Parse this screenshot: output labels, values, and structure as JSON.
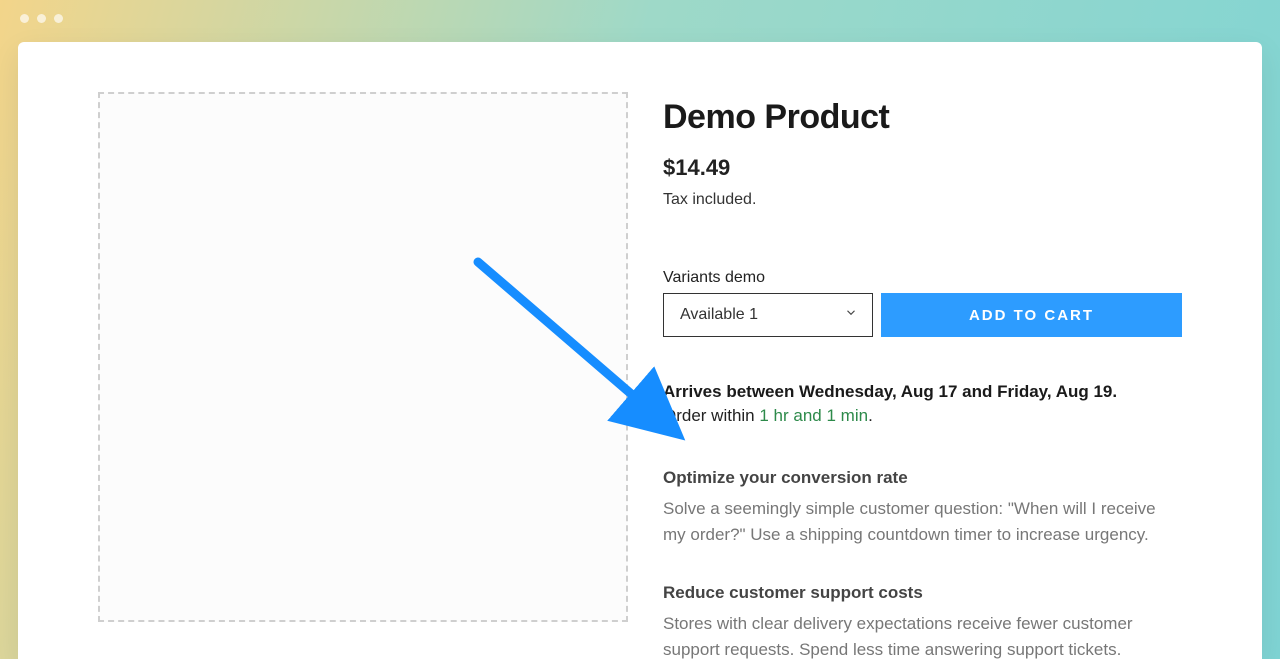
{
  "product": {
    "title": "Demo Product",
    "price": "$14.49",
    "tax_note": "Tax included.",
    "variants_label": "Variants demo",
    "selected_variant": "Available 1",
    "add_to_cart_label": "ADD TO CART"
  },
  "shipping": {
    "arrives_line": "Arrives between Wednesday, Aug 17 and Friday, Aug 19.",
    "order_within_prefix": "Order within ",
    "order_within_time": "1 hr and 1 min",
    "order_within_suffix": "."
  },
  "blocks": [
    {
      "heading": "Optimize your conversion rate",
      "body": "Solve a seemingly simple customer question: \"When will I receive my order?\" Use a shipping countdown timer to increase urgency."
    },
    {
      "heading": "Reduce customer support costs",
      "body": "Stores with clear delivery expectations receive fewer customer support requests. Spend less time answering support tickets."
    }
  ]
}
